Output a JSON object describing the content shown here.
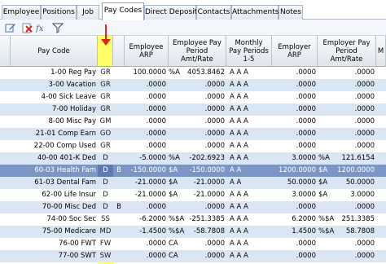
{
  "tabs": [
    "Employee",
    "Positions",
    "Job",
    "Pay Codes",
    "Direct Deposit",
    "Contacts",
    "Attachments",
    "Notes"
  ],
  "active_tab": "Pay Codes",
  "toolbar": {
    "icons": [
      "edit-icon",
      "delete-icon",
      "fx-icon",
      "filter-icon"
    ]
  },
  "columns": {
    "pay_code": "Pay Code",
    "code_type": "",
    "flag": "",
    "employee_arp": "Employee ARP",
    "employee_pay_period_amt": "Employee Pay Period Amt/Rate",
    "monthly_pay_periods": "Monthly Pay Periods 1-5",
    "employer_arp": "Employer ARP",
    "employer_pay_period_amt": "Employer Pay Period Amt/Rate",
    "m": "M"
  },
  "rows": [
    {
      "pay_code": "1-00  Reg Pay",
      "type": "GR",
      "flag": "",
      "emp_arp": "100.0000",
      "emp_unit": "%A",
      "emp_amt": "4053.8462",
      "periods": "A  A  A",
      "er_arp": ".0000",
      "er_unit": "",
      "er_amt": ".0000"
    },
    {
      "pay_code": "3-00  Vacation",
      "type": "GR",
      "flag": "",
      "emp_arp": ".0000",
      "emp_unit": "",
      "emp_amt": ".0000",
      "periods": "A  A  A",
      "er_arp": ".0000",
      "er_unit": "",
      "er_amt": ".0000"
    },
    {
      "pay_code": "4-00  Sick Leave",
      "type": "GR",
      "flag": "",
      "emp_arp": ".0000",
      "emp_unit": "",
      "emp_amt": ".0000",
      "periods": "A  A  A",
      "er_arp": ".0000",
      "er_unit": "",
      "er_amt": ".0000"
    },
    {
      "pay_code": "7-00  Holiday",
      "type": "GR",
      "flag": "",
      "emp_arp": ".0000",
      "emp_unit": "",
      "emp_amt": ".0000",
      "periods": "A  A  A",
      "er_arp": ".0000",
      "er_unit": "",
      "er_amt": ".0000"
    },
    {
      "pay_code": "8-00  Misc Pay",
      "type": "GM",
      "flag": "",
      "emp_arp": ".0000",
      "emp_unit": "",
      "emp_amt": ".0000",
      "periods": "A  A  A",
      "er_arp": ".0000",
      "er_unit": "",
      "er_amt": ".0000"
    },
    {
      "pay_code": "21-01  Comp Earn",
      "type": "GO",
      "flag": "",
      "emp_arp": ".0000",
      "emp_unit": "",
      "emp_amt": ".0000",
      "periods": "A  A  A",
      "er_arp": ".0000",
      "er_unit": "",
      "er_amt": ".0000"
    },
    {
      "pay_code": "22-00  Comp Used",
      "type": "GR",
      "flag": "",
      "emp_arp": ".0000",
      "emp_unit": "",
      "emp_amt": ".0000",
      "periods": "A  A  A",
      "er_arp": ".0000",
      "er_unit": "",
      "er_amt": ".0000"
    },
    {
      "pay_code": "40-00  401-K Ded",
      "type": "D",
      "flag": "",
      "emp_arp": "-5.0000",
      "emp_unit": "%A",
      "emp_amt": "-202.6923",
      "periods": "A  A  A",
      "er_arp": "3.0000",
      "er_unit": "%A",
      "er_amt": "121.6154"
    },
    {
      "pay_code": "60-03  Health Fam",
      "type": "D",
      "flag": "B",
      "emp_arp": "-150.0000",
      "emp_unit": "$A",
      "emp_amt": "-150.0000",
      "periods": "A  A",
      "er_arp": "1200.0000",
      "er_unit": "$A",
      "er_amt": "1200.0000"
    },
    {
      "pay_code": "61-03  Dental Fam",
      "type": "D",
      "flag": "",
      "emp_arp": "-21.0000",
      "emp_unit": "$A",
      "emp_amt": "-21.0000",
      "periods": "A  A",
      "er_arp": "50.0000",
      "er_unit": "$A",
      "er_amt": "50.0000"
    },
    {
      "pay_code": "62-00  Life Insur",
      "type": "D",
      "flag": "",
      "emp_arp": "-21.0000",
      "emp_unit": "$A",
      "emp_amt": "-21.0000",
      "periods": "A  A  A",
      "er_arp": "3.0000",
      "er_unit": "$A",
      "er_amt": "3.0000"
    },
    {
      "pay_code": "70-00  Misc Ded",
      "type": "D",
      "flag": "B",
      "emp_arp": ".0000",
      "emp_unit": "",
      "emp_amt": ".0000",
      "periods": "A  A  A",
      "er_arp": ".0000",
      "er_unit": "",
      "er_amt": ".0000"
    },
    {
      "pay_code": "74-00  Soc Sec",
      "type": "SS",
      "flag": "",
      "emp_arp": "-6.2000",
      "emp_unit": "%$A",
      "emp_amt": "-251.3385",
      "periods": "A  A  A",
      "er_arp": "6.2000",
      "er_unit": "%$A",
      "er_amt": "251.3385"
    },
    {
      "pay_code": "75-00  Medicare",
      "type": "MD",
      "flag": "",
      "emp_arp": "-1.4500",
      "emp_unit": "%$A",
      "emp_amt": "-58.7808",
      "periods": "A  A  A",
      "er_arp": "1.4500",
      "er_unit": "%$A",
      "er_amt": "58.7808"
    },
    {
      "pay_code": "76-00  FWT",
      "type": "FW",
      "flag": "",
      "emp_arp": ".0000",
      "emp_unit": "CA",
      "emp_amt": ".0000",
      "periods": "A  A  A",
      "er_arp": ".0000",
      "er_unit": "",
      "er_amt": ".0000"
    },
    {
      "pay_code": "77-00  SWT",
      "type": "SW",
      "flag": "",
      "emp_arp": ".0000",
      "emp_unit": "CA",
      "emp_amt": ".0000",
      "periods": "A  A  A",
      "er_arp": ".0000",
      "er_unit": "",
      "er_amt": ".0000"
    }
  ],
  "selected_row": 8,
  "colors": {
    "highlight": "#ffff66",
    "selected": "#7b96c4",
    "alt_row": "#dbe6f4",
    "annotation_arrow": "#e2231a"
  }
}
